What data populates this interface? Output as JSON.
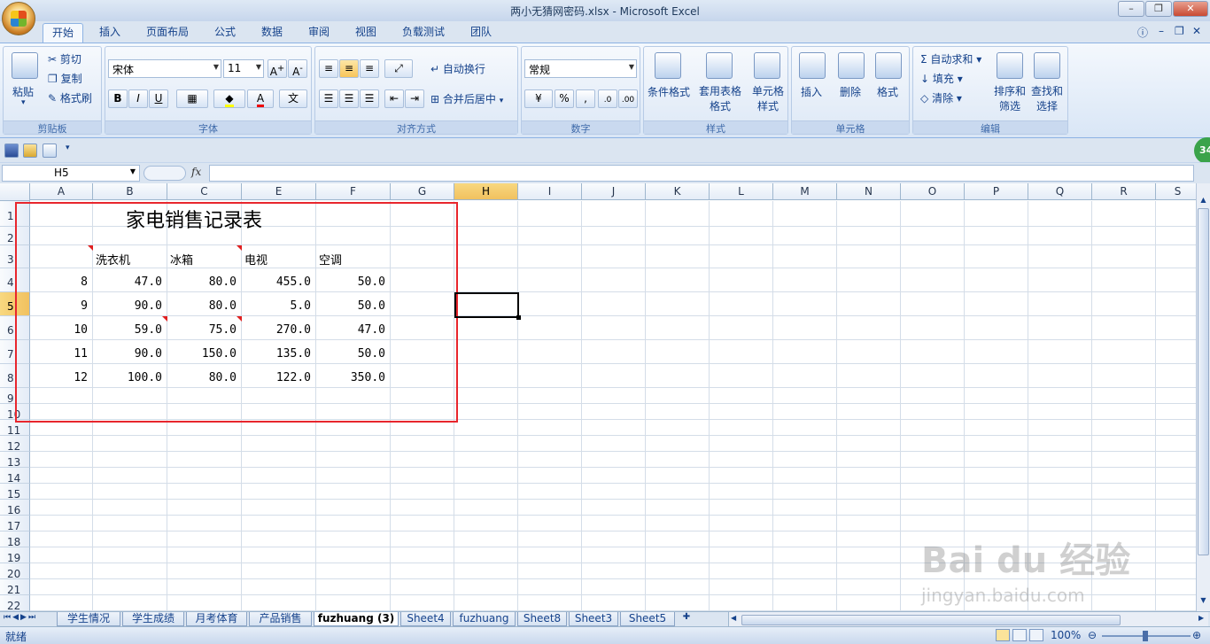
{
  "window": {
    "title": "两小无猜网密码.xlsx - Microsoft Excel"
  },
  "ribbon_tabs": [
    "开始",
    "插入",
    "页面布局",
    "公式",
    "数据",
    "审阅",
    "视图",
    "负载测试",
    "团队"
  ],
  "clipboard": {
    "paste": "粘贴",
    "cut": "剪切",
    "copy": "复制",
    "format_painter": "格式刷",
    "label": "剪贴板"
  },
  "font": {
    "name": "宋体",
    "size": "11",
    "label": "字体",
    "bold": "B",
    "italic": "I",
    "underline": "U"
  },
  "alignment": {
    "wrap": "自动换行",
    "merge": "合并后居中",
    "label": "对齐方式"
  },
  "number": {
    "format": "常规",
    "percent": "%",
    "comma": ",",
    "label": "数字"
  },
  "styles": {
    "conditional": "条件格式",
    "table_format": "套用表格格式",
    "cell_style": "单元格样式",
    "label": "样式"
  },
  "cells": {
    "insert": "插入",
    "delete": "删除",
    "format": "格式",
    "label": "单元格"
  },
  "editing": {
    "autosum": "自动求和",
    "fill": "填充",
    "clear": "清除",
    "sort_filter": "排序和筛选",
    "find_select": "查找和选择",
    "label": "编辑"
  },
  "formula_bar": {
    "name_box": "H5",
    "fx": "fx",
    "value": ""
  },
  "columns": [
    "A",
    "B",
    "C",
    "E",
    "F",
    "G",
    "H",
    "I",
    "J",
    "K",
    "L",
    "M",
    "N",
    "O",
    "P",
    "Q",
    "R",
    "S"
  ],
  "rows": [
    "1",
    "2",
    "3",
    "4",
    "5",
    "6",
    "7",
    "8",
    "9",
    "10",
    "11",
    "12",
    "13",
    "14",
    "15",
    "16",
    "17",
    "18",
    "19",
    "20",
    "21",
    "22"
  ],
  "sheet": {
    "title": "家电销售记录表",
    "headers": [
      "洗衣机",
      "冰箱",
      "电视",
      "空调"
    ],
    "data": [
      [
        "8",
        "47.0",
        "80.0",
        "455.0",
        "50.0"
      ],
      [
        "9",
        "90.0",
        "80.0",
        "5.0",
        "50.0"
      ],
      [
        "10",
        "59.0",
        "75.0",
        "270.0",
        "47.0"
      ],
      [
        "11",
        "90.0",
        "150.0",
        "135.0",
        "50.0"
      ],
      [
        "12",
        "100.0",
        "80.0",
        "122.0",
        "350.0"
      ]
    ]
  },
  "sheet_tabs": [
    "学生情况",
    "学生成绩",
    "月考体育",
    "产品销售",
    "fuzhuang (3)",
    "Sheet4",
    "fuzhuang",
    "Sheet8",
    "Sheet3",
    "Sheet5"
  ],
  "active_sheet_index": 4,
  "status": {
    "ready": "就绪",
    "zoom": "100%"
  },
  "badge": "34",
  "watermark": {
    "brand": "Bai du 经验",
    "url": "jingyan.baidu.com"
  }
}
